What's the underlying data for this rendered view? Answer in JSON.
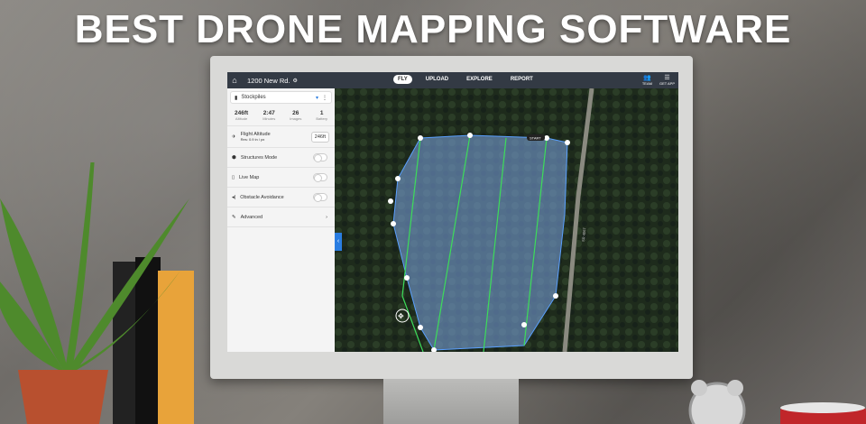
{
  "headline": "BEST DRONE MAPPING SOFTWARE",
  "topbar": {
    "location": "1200 New Rd.",
    "tabs": [
      "FLY",
      "UPLOAD",
      "EXPLORE",
      "REPORT"
    ],
    "active_tab": "FLY",
    "team_label": "TEAM",
    "get_app_label": "GET APP"
  },
  "panel": {
    "mode_select": "Stockpiles",
    "stats": [
      {
        "value": "246ft",
        "label": "Altitude"
      },
      {
        "value": "2:47",
        "label": "Minutes"
      },
      {
        "value": "26",
        "label": "Images"
      },
      {
        "value": "1",
        "label": "Battery"
      }
    ],
    "flight_altitude": {
      "label": "Flight Altitude",
      "sub": "Res: 0.9 in / px",
      "value": "246ft"
    },
    "toggles": [
      {
        "label": "Structures Mode",
        "on": false
      },
      {
        "label": "Live Map",
        "on": false
      },
      {
        "label": "Obstacle Avoidance",
        "on": false
      }
    ],
    "advanced": "Advanced"
  },
  "map": {
    "start_label": "START",
    "road_label": "SR 4067"
  },
  "colors": {
    "accent": "#2a7de1",
    "topbar": "#333a44",
    "overlay": "#6f93c8",
    "flight_line": "#3ddc5a"
  }
}
